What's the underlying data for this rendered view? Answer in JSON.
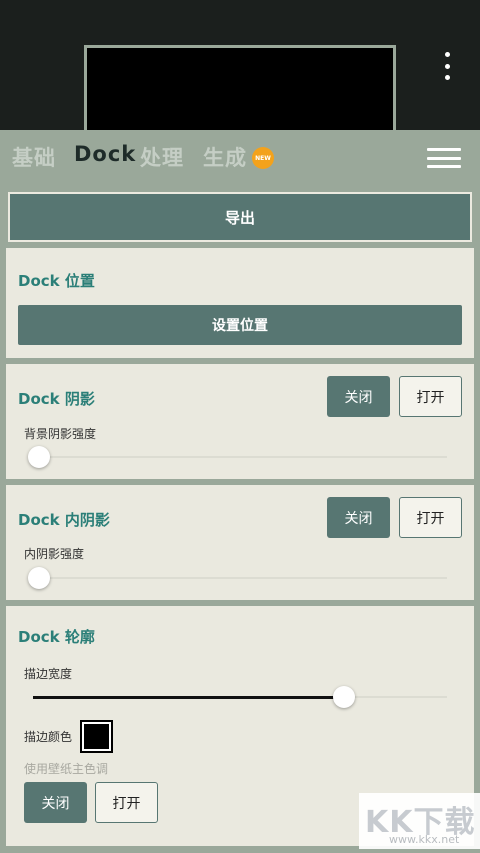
{
  "tabs": [
    {
      "label": "基础"
    },
    {
      "label": "Dock"
    },
    {
      "label": "处理"
    },
    {
      "label": "生成"
    }
  ],
  "new_badge": "NEW",
  "export_label": "导出",
  "dock_position": {
    "title": "Dock 位置",
    "button_label": "设置位置"
  },
  "dock_shadow": {
    "title": "Dock 阴影",
    "off_label": "关闭",
    "on_label": "打开",
    "slider_label": "背景阴影强度",
    "slider_value": 0
  },
  "dock_inner_shadow": {
    "title": "Dock 内阴影",
    "off_label": "关闭",
    "on_label": "打开",
    "slider_label": "内阴影强度",
    "slider_value": 0
  },
  "dock_outline": {
    "title": "Dock 轮廓",
    "slider_label": "描边宽度",
    "slider_value": 0.75,
    "color_label": "描边颜色",
    "color_value": "#000000",
    "hint": "使用壁纸主色调",
    "off_label": "关闭",
    "on_label": "打开"
  },
  "watermark": {
    "text": "KK下载",
    "url": "www.kkx.net"
  },
  "colors": {
    "accent": "#577672",
    "title": "#2b7f78",
    "badge": "#f3a21c"
  }
}
